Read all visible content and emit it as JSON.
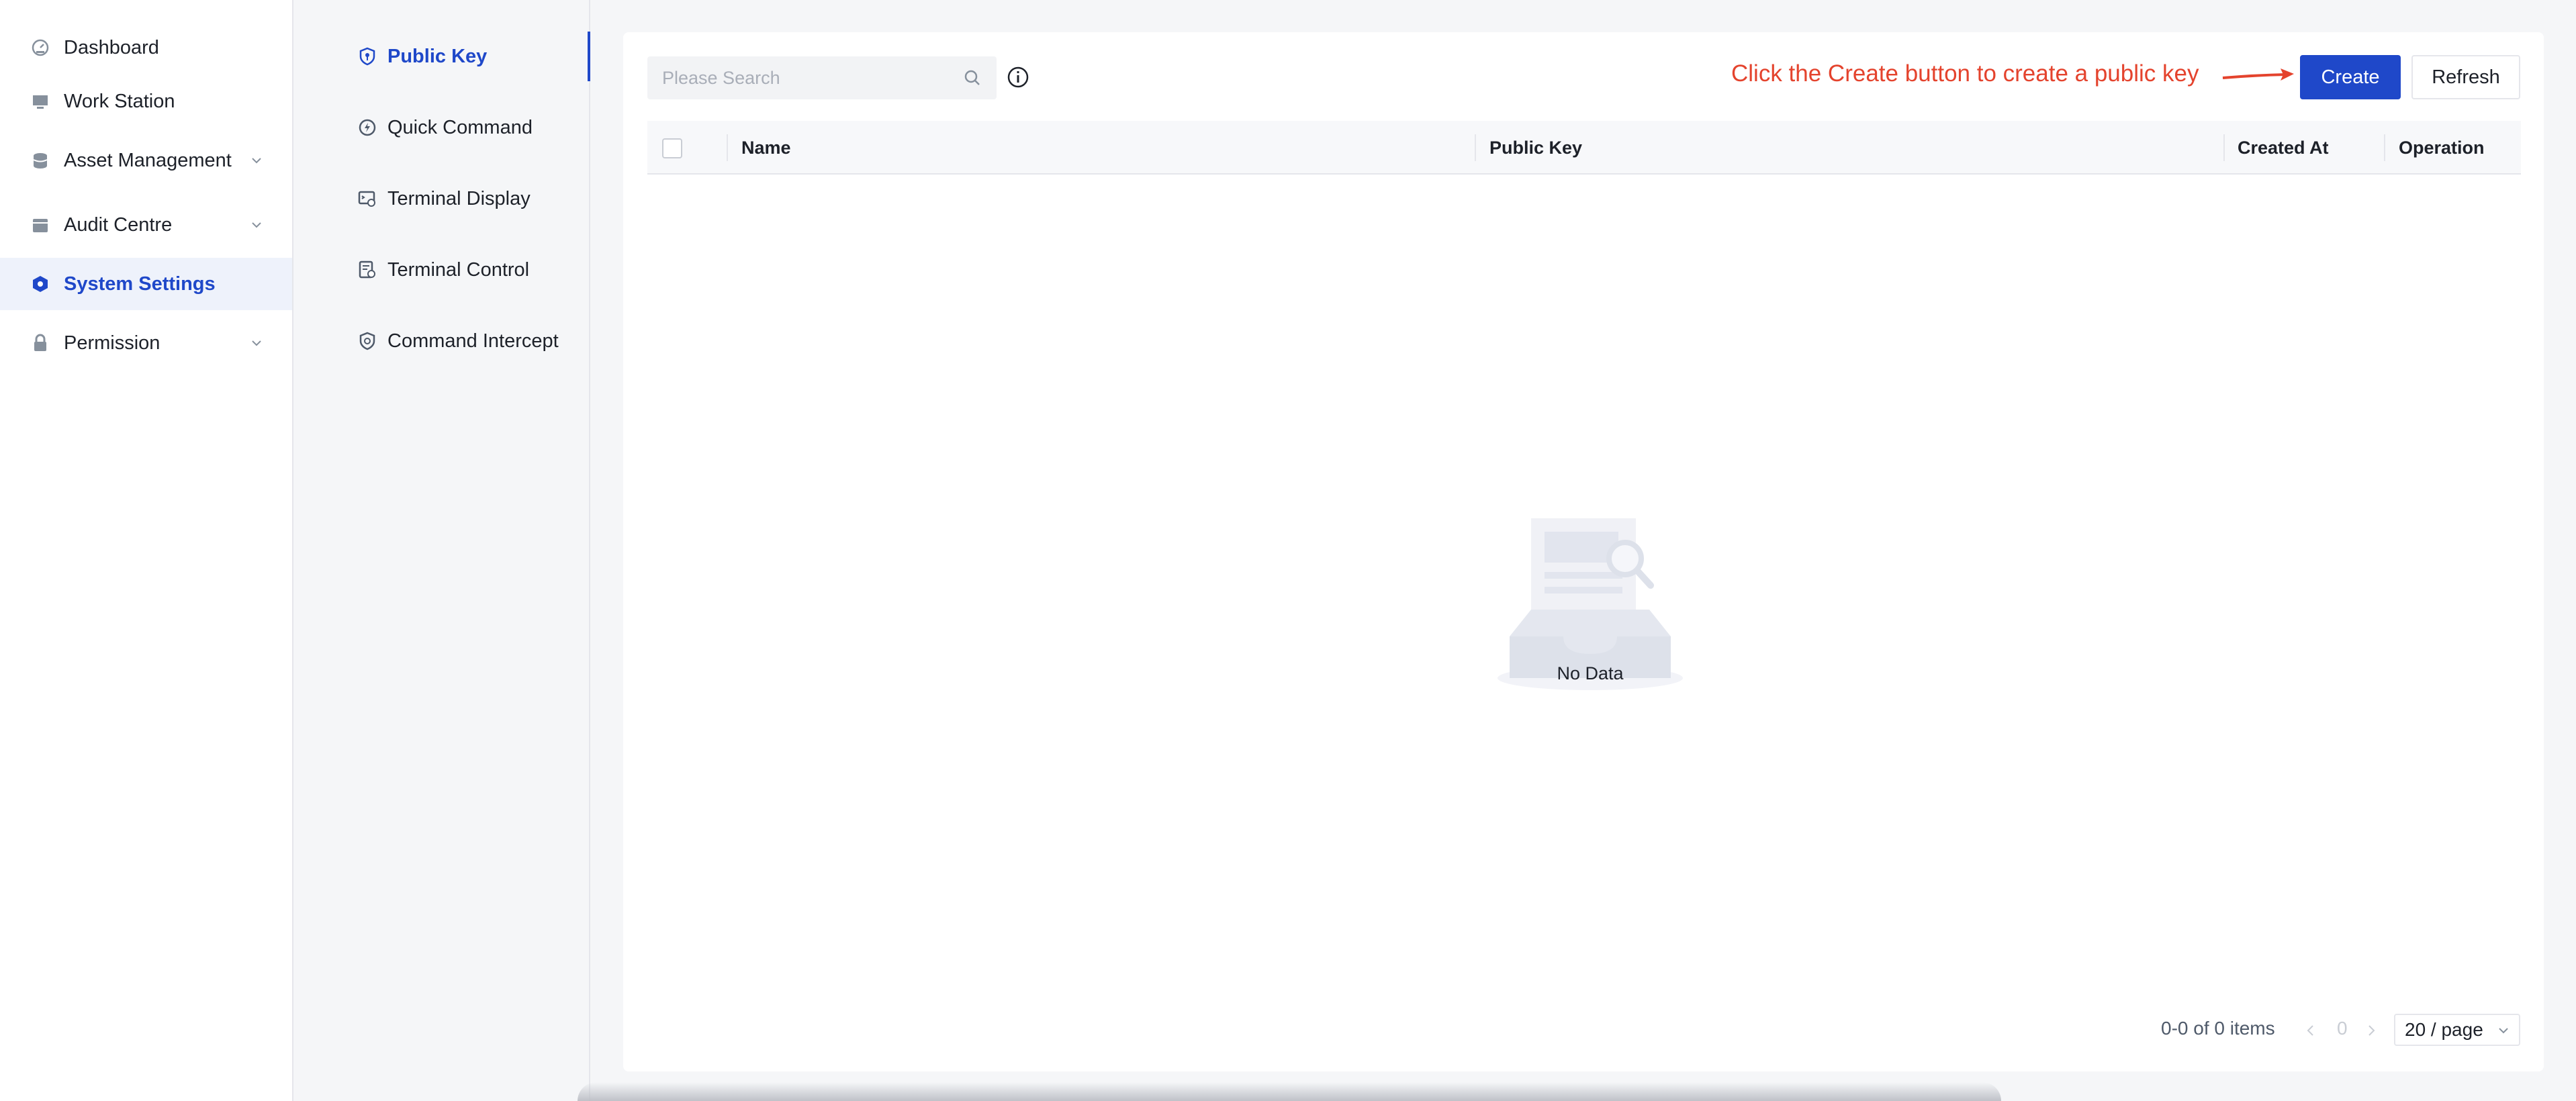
{
  "sidebar": {
    "items": [
      {
        "label": "Dashboard",
        "icon": "dashboard-icon"
      },
      {
        "label": "Work Station",
        "icon": "monitor-icon"
      },
      {
        "label": "Asset Management",
        "icon": "database-icon",
        "expandable": true
      },
      {
        "label": "Audit Centre",
        "icon": "calendar-icon",
        "expandable": true
      },
      {
        "label": "System Settings",
        "icon": "gear-icon",
        "active": true
      },
      {
        "label": "Permission",
        "icon": "lock-icon",
        "expandable": true
      }
    ]
  },
  "settings_menu": {
    "items": [
      {
        "label": "Public Key",
        "icon": "key-shield-icon",
        "active": true
      },
      {
        "label": "Quick Command",
        "icon": "lightning-icon"
      },
      {
        "label": "Terminal Display",
        "icon": "display-icon"
      },
      {
        "label": "Terminal Control",
        "icon": "control-icon"
      },
      {
        "label": "Command Intercept",
        "icon": "shield-icon"
      }
    ]
  },
  "toolbar": {
    "search_placeholder": "Please Search",
    "annotation": "Click the Create button to create a public key",
    "create_label": "Create",
    "refresh_label": "Refresh"
  },
  "table": {
    "columns": [
      "Name",
      "Public Key",
      "Created At",
      "Operation"
    ],
    "rows": [],
    "empty_text": "No Data"
  },
  "pagination": {
    "total_text": "0-0 of 0 items",
    "current_page": "0",
    "page_size": "20 / page"
  },
  "colors": {
    "primary": "#1f48c9",
    "annotation": "#e4432d"
  }
}
